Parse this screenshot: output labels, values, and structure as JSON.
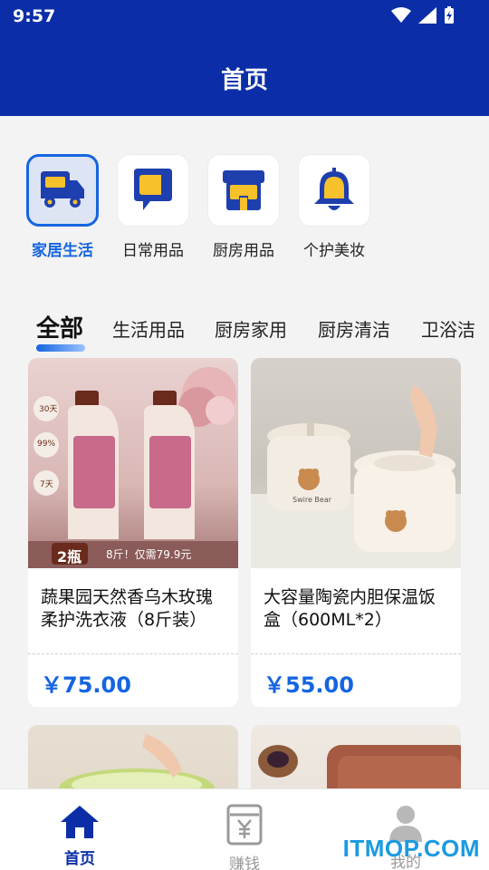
{
  "status": {
    "time": "9:57"
  },
  "header": {
    "title": "首页"
  },
  "categories": [
    {
      "label": "家居生活",
      "icon": "truck-icon",
      "active": true
    },
    {
      "label": "日常用品",
      "icon": "chat-icon",
      "active": false
    },
    {
      "label": "厨房用品",
      "icon": "store-icon",
      "active": false
    },
    {
      "label": "个护美妆",
      "icon": "bell-icon",
      "active": false
    }
  ],
  "subtabs": [
    "全部",
    "生活用品",
    "厨房家用",
    "厨房清洁",
    "卫浴洁"
  ],
  "products": [
    {
      "name": "蔬果园天然香乌木玫瑰柔护洗衣液（8斤装）",
      "price": "￥75.00",
      "img_text": {
        "badge": "2瓶",
        "promo": "8斤！仅需79.9元",
        "b1": "30天",
        "b2": "99%",
        "b3": "7天"
      }
    },
    {
      "name": "大容量陶瓷内胆保温饭盒（600ML*2）",
      "price": "￥55.00",
      "img_text": {
        "brand": "Swire Bear"
      }
    }
  ],
  "bottom_nav": [
    {
      "label": "首页",
      "icon": "home-icon",
      "active": true
    },
    {
      "label": "赚钱",
      "icon": "wallet-yen-icon",
      "active": false
    },
    {
      "label": "我的",
      "icon": "user-icon",
      "active": false
    }
  ],
  "watermark": "ITMOP.COM",
  "colors": {
    "primary": "#0b2ea8",
    "accent": "#1565e0",
    "icon_yellow": "#f7c12b"
  }
}
